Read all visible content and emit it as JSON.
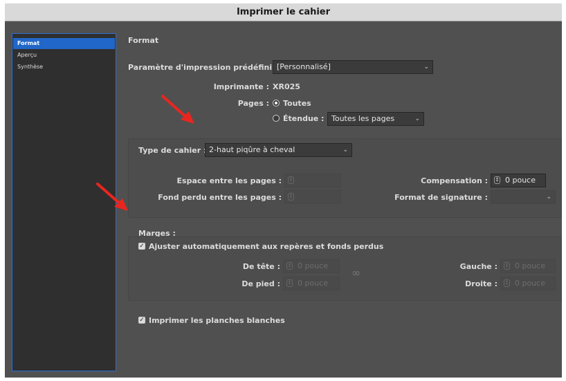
{
  "window": {
    "title": "Imprimer le cahier"
  },
  "sidebar": {
    "items": [
      {
        "label": "Format",
        "selected": true
      },
      {
        "label": "Aperçu",
        "selected": false
      },
      {
        "label": "Synthèse",
        "selected": false
      }
    ]
  },
  "main": {
    "heading": "Format",
    "preset": {
      "label": "Paramètre d'impression prédéfini :",
      "value": "[Personnalisé]"
    },
    "printer": {
      "label": "Imprimante :",
      "value": "XR025"
    },
    "pages": {
      "label": "Pages :",
      "all_label": "Toutes",
      "range_label": "Étendue :",
      "range_value": "Toutes les pages",
      "selected": "Toutes"
    },
    "booklet": {
      "type_label": "Type de cahier :",
      "type_value": "2-haut piqûre à cheval",
      "space_label": "Espace entre les pages :",
      "space_value": "",
      "bleed_label": "Fond perdu entre les pages :",
      "bleed_value": "",
      "creep_label": "Compensation :",
      "creep_value": "0 pouce",
      "signature_label": "Format de signature :",
      "signature_value": ""
    },
    "margins": {
      "label": "Marges :",
      "auto_label": "Ajuster automatiquement aux repères et fonds perdus",
      "auto_checked": true,
      "top_label": "De tête :",
      "top_value": "0 pouce",
      "bottom_label": "De pied :",
      "bottom_value": "0 pouce",
      "left_label": "Gauche :",
      "left_value": "0 pouce",
      "right_label": "Droite :",
      "right_value": "0 pouce"
    },
    "blank_spreads": {
      "label": "Imprimer les planches blanches",
      "checked": true
    }
  },
  "colors": {
    "arrow": "#e8261f",
    "selection": "#2167c9"
  },
  "icons": [
    "chevron-down-icon",
    "radio-icon",
    "checkbox-icon",
    "spinner-icon",
    "link-chain-icon",
    "red-arrow-icon"
  ]
}
